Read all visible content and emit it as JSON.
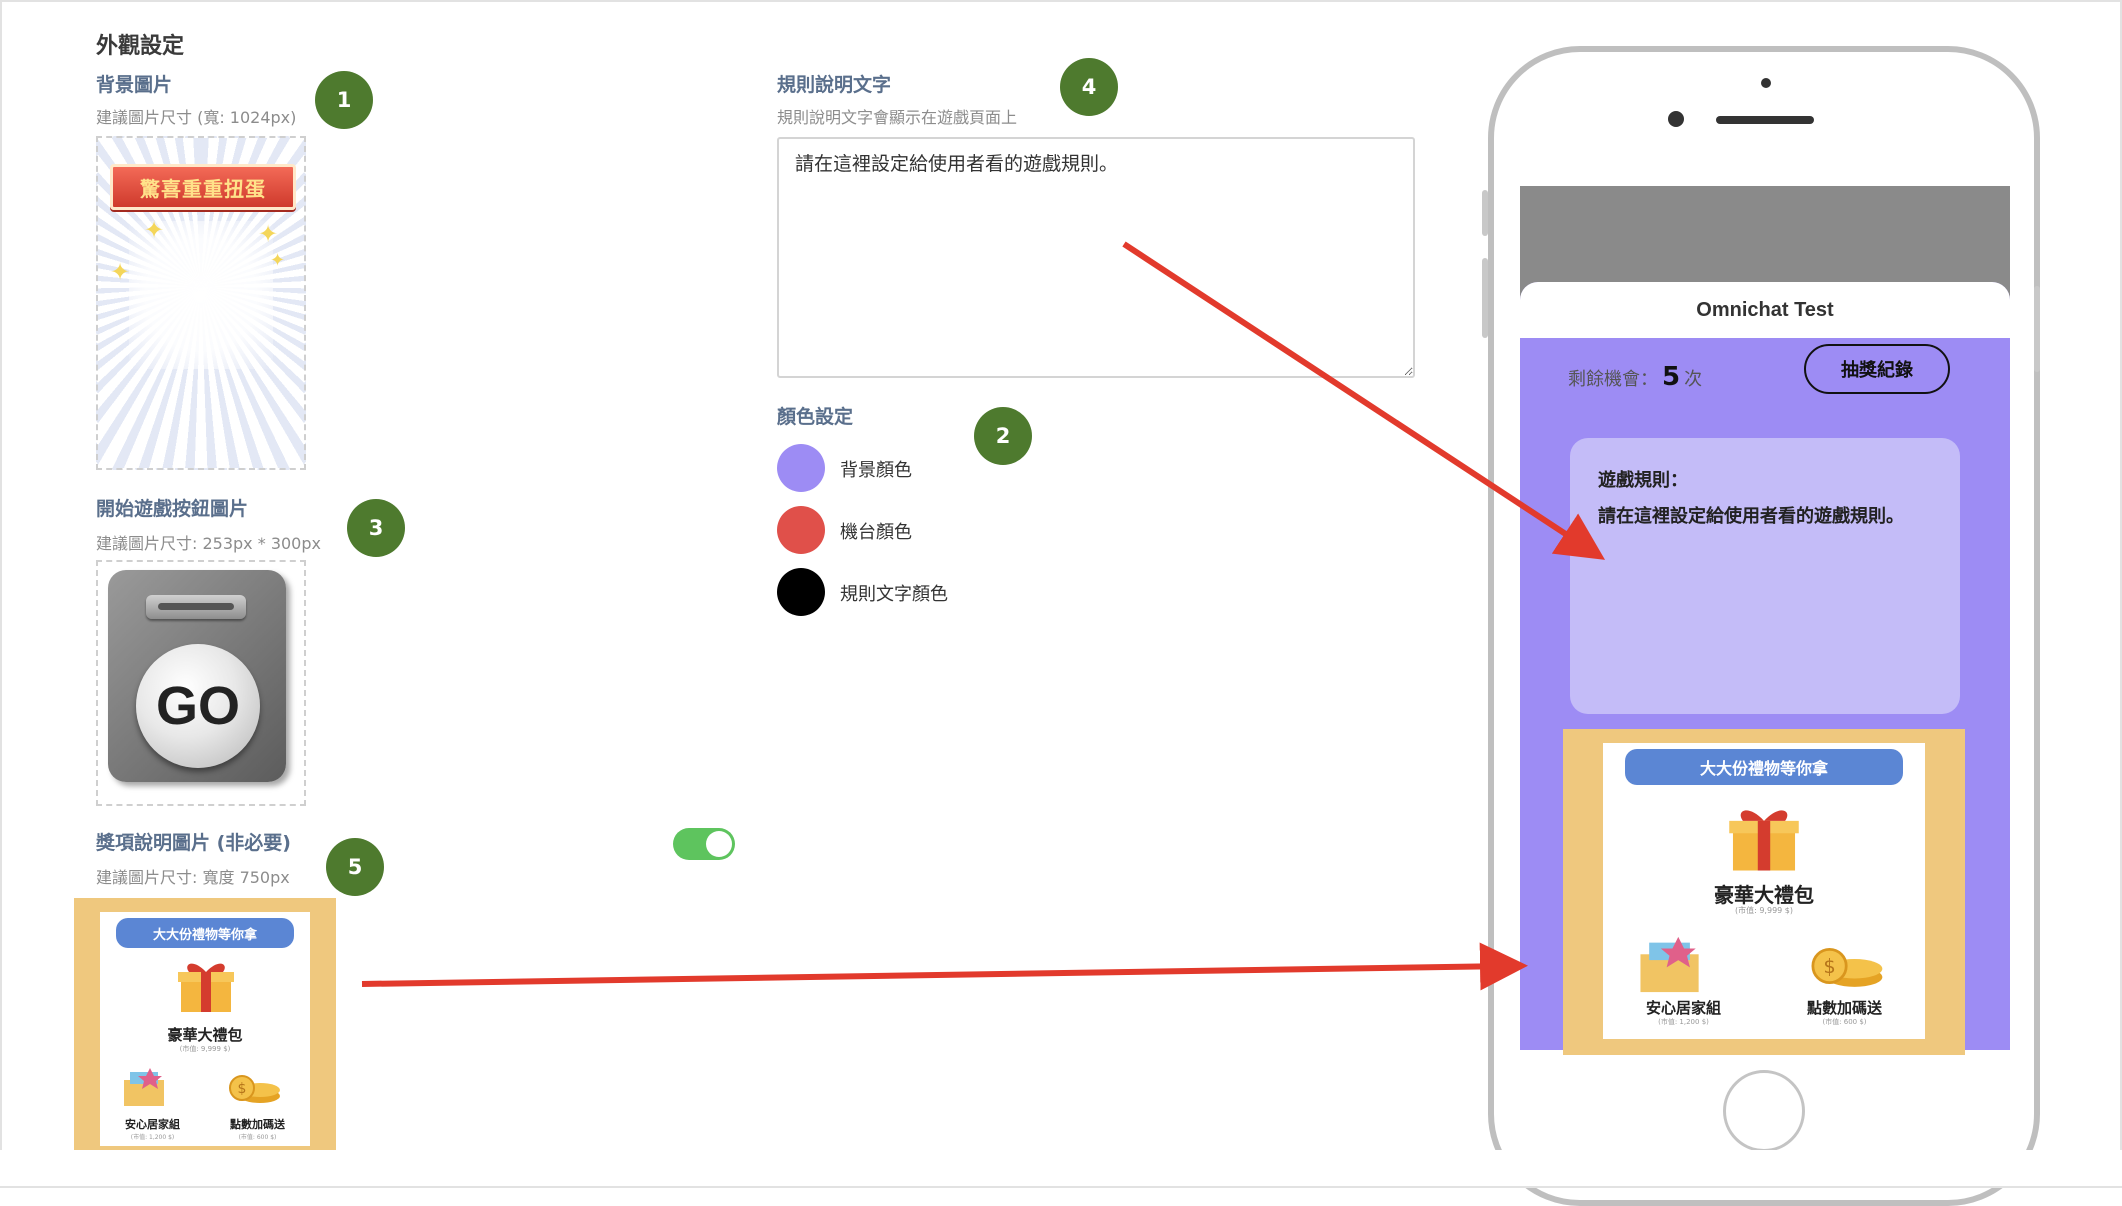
{
  "section_title": "外觀設定",
  "background_image": {
    "label": "背景圖片",
    "hint": "建議圖片尺寸 (寬: 1024px)",
    "banner_text": "驚喜重重扭蛋"
  },
  "start_button_image": {
    "label": "開始遊戲按鈕圖片",
    "hint": "建議圖片尺寸: 253px * 300px",
    "go_text": "GO"
  },
  "prize_image": {
    "label": "獎項說明圖片 (非必要)",
    "hint": "建議圖片尺寸: 寬度 750px",
    "toggle_on": true
  },
  "rules_text": {
    "label": "規則說明文字",
    "hint": "規則說明文字會顯示在遊戲頁面上",
    "value": "請在這裡設定給使用者看的遊戲規則。"
  },
  "color_settings": {
    "label": "顏色設定",
    "items": [
      {
        "label": "背景顏色",
        "color": "#9d8cf4"
      },
      {
        "label": "機台顏色",
        "color": "#e0504a"
      },
      {
        "label": "規則文字顏色",
        "color": "#000000"
      }
    ]
  },
  "badges": [
    "1",
    "2",
    "3",
    "4",
    "5"
  ],
  "prize_card": {
    "header": "大大份禮物等你拿",
    "main_prize": "豪華大禮包",
    "main_prize_value": "(市值: 9,999 $)",
    "prize_2": "安心居家組",
    "prize_2_value": "(市值: 1,200 $)",
    "prize_3": "點數加碼送",
    "prize_3_value": "(市值: 600 $)"
  },
  "phone_preview": {
    "app_title": "Omnichat Test",
    "chances_label": "剩餘機會：",
    "chances_count": "5",
    "chances_unit": "次",
    "record_button": "抽獎紀錄",
    "rules_title": "遊戲規則：",
    "rules_body": "請在這裡設定給使用者看的遊戲規則。"
  },
  "colors": {
    "badge": "#4e7a2e",
    "arrow": "#e23a2c",
    "toggle": "#5ec45e",
    "label": "#5a6f8c",
    "prize_bg": "#efc87e",
    "prize_pill": "#5b86d4"
  }
}
